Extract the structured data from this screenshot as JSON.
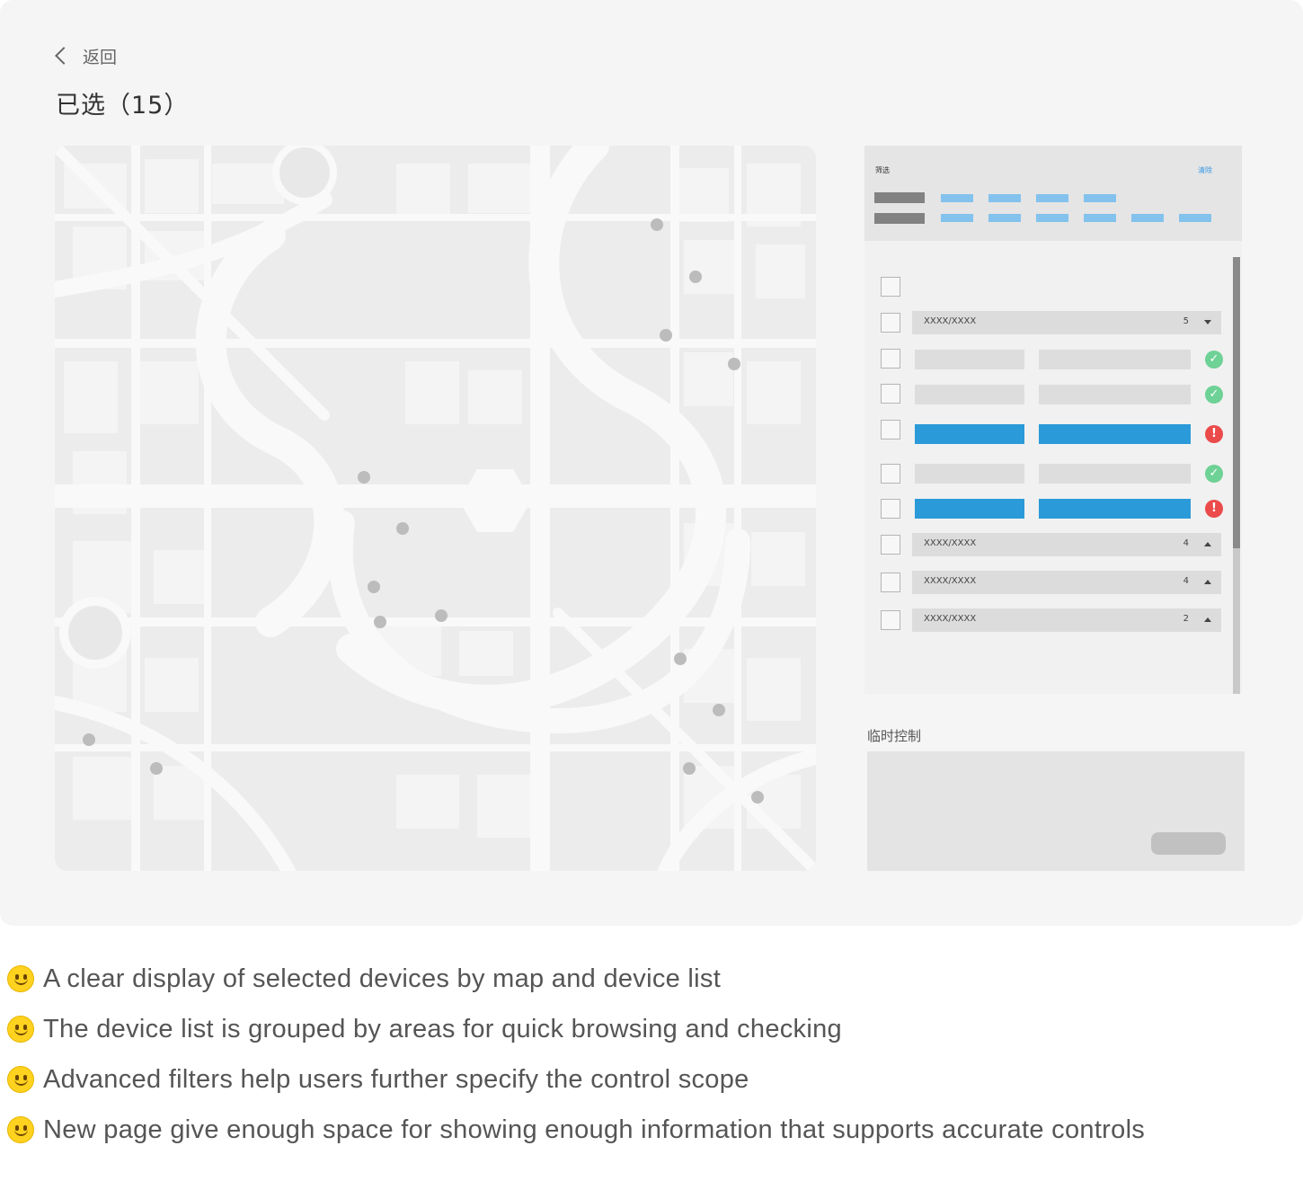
{
  "header": {
    "back_label": "返回",
    "title": "已选（15）"
  },
  "filter": {
    "title": "筛选",
    "clear_label": "清除"
  },
  "device_list": {
    "groups": [
      {
        "name": "XXXX/XXXX",
        "count": "5",
        "state": "expanded"
      },
      {
        "name": "XXXX/XXXX",
        "count": "4",
        "state": "collapsed"
      },
      {
        "name": "XXXX/XXXX",
        "count": "4",
        "state": "collapsed"
      },
      {
        "name": "XXXX/XXXX",
        "count": "2",
        "state": "collapsed"
      }
    ],
    "device_statuses": [
      "ok",
      "ok",
      "error",
      "ok",
      "error"
    ]
  },
  "temp_control": {
    "label": "临时控制"
  },
  "colors": {
    "accent_blue": "#2b9ad8",
    "status_ok": "#6ed195",
    "status_error": "#eb4b4b",
    "chip_blue": "#83c2ed"
  },
  "notes": [
    {
      "icon": "smiley-icon",
      "text": "A clear display of selected devices by map and device list"
    },
    {
      "icon": "smiley-icon",
      "text": "The device list is grouped by areas for quick browsing and checking"
    },
    {
      "icon": "smiley-icon",
      "text": "Advanced filters help users further specify the control scope"
    },
    {
      "icon": "smiley-icon",
      "text": "New page give enough space for showing enough information that supports accurate controls"
    }
  ]
}
